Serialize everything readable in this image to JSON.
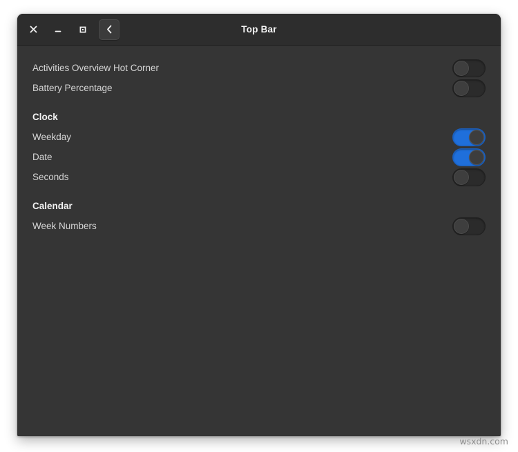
{
  "window": {
    "title": "Top Bar",
    "controls": {
      "close_label": "×",
      "minimize_label": "_",
      "maximize_label": "□",
      "back_label": "‹"
    }
  },
  "settings": {
    "top_items": [
      {
        "label": "Activities Overview Hot Corner",
        "state": "off"
      },
      {
        "label": "Battery Percentage",
        "state": "off"
      }
    ],
    "groups": [
      {
        "title": "Clock",
        "items": [
          {
            "label": "Weekday",
            "state": "on"
          },
          {
            "label": "Date",
            "state": "on"
          },
          {
            "label": "Seconds",
            "state": "off"
          }
        ]
      },
      {
        "title": "Calendar",
        "items": [
          {
            "label": "Week Numbers",
            "state": "off"
          }
        ]
      }
    ]
  },
  "colors": {
    "accent": "#1f6fdb",
    "window_bg": "#353535",
    "titlebar_bg": "#2d2d2d",
    "text": "#d6d6d6",
    "heading": "#f2f2f2"
  },
  "watermark": "wsxdn.com"
}
